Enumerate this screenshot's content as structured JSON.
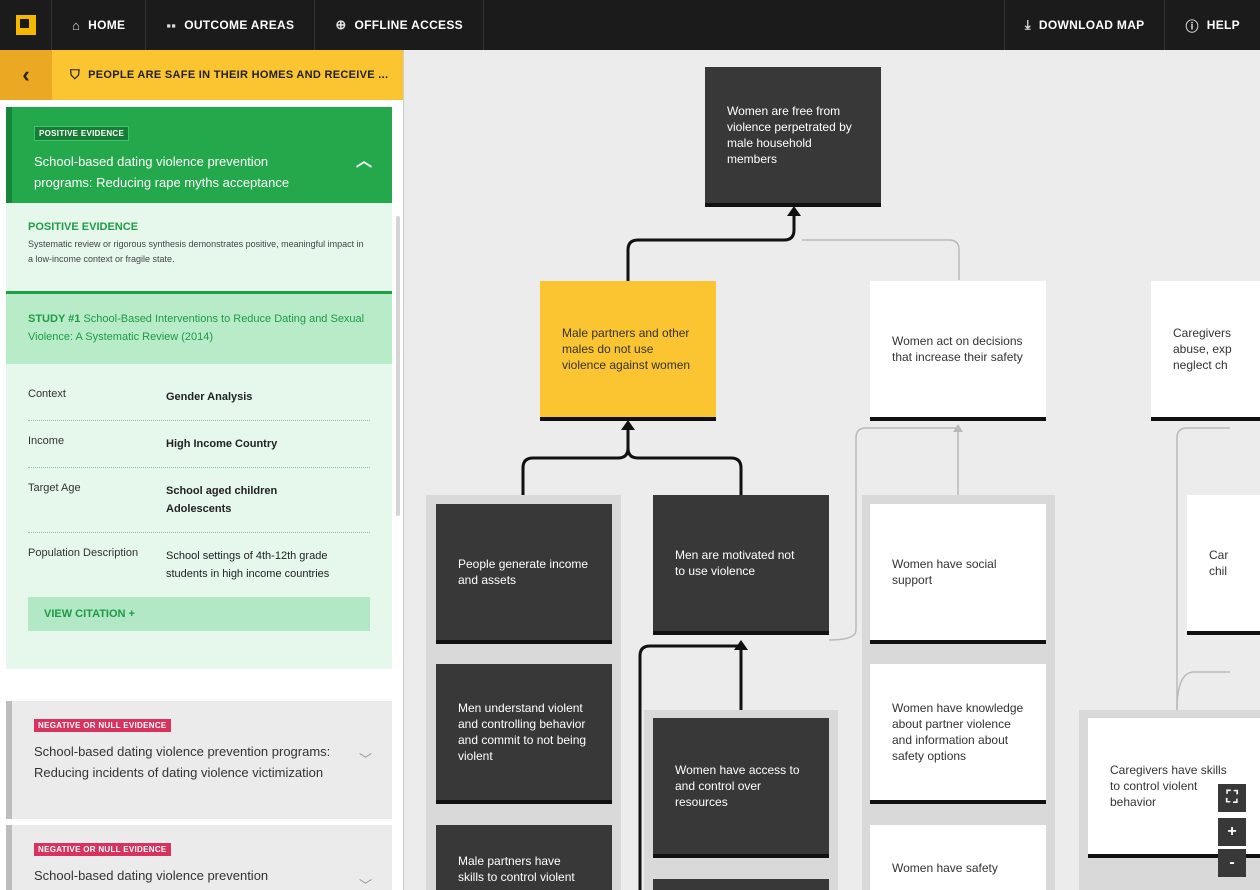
{
  "nav": {
    "home": "HOME",
    "outcome_areas": "OUTCOME AREAS",
    "offline_access": "OFFLINE ACCESS",
    "download_map": "DOWNLOAD MAP",
    "help": "HELP"
  },
  "panel": {
    "title": "PEOPLE ARE SAFE IN THEIR HOMES AND RECEIVE ...",
    "open_card": {
      "badge": "POSITIVE EVIDENCE",
      "title": "School-based dating violence prevention programs: Reducing rape myths acceptance",
      "evidence_title": "POSITIVE EVIDENCE",
      "evidence_desc": "Systematic review or rigorous synthesis demonstrates positive, meaningful impact in a low-income context or fragile state.",
      "study_label": "STUDY #1",
      "study_title": "School-Based Interventions to Reduce Dating and Sexual Violence: A Systematic Review (2014)",
      "details": [
        {
          "label": "Context",
          "value": "Gender Analysis"
        },
        {
          "label": "Income",
          "value": "High Income Country"
        },
        {
          "label": "Target Age",
          "value": "School aged children",
          "value2": "Adolescents"
        },
        {
          "label": "Population Description",
          "value": "School settings of 4th-12th grade students in high income countries"
        }
      ],
      "citation_label": "VIEW CITATION +"
    },
    "closed_cards": [
      {
        "badge": "NEGATIVE OR NULL EVIDENCE",
        "title": "School-based dating violence prevention programs: Reducing incidents of dating violence victimization"
      },
      {
        "badge": "NEGATIVE OR NULL EVIDENCE",
        "title": "School-based dating violence prevention"
      }
    ]
  },
  "map": {
    "nodes": {
      "top": "Women are free from violence perpetrated by male household members",
      "male_partners": "Male partners and other males do not use violence against women",
      "women_act": "Women act on decisions that increase their safety",
      "caregivers_partial": "Caregivers abuse, exp neglect ch",
      "people_generate": "People generate income and assets",
      "men_motivated": "Men are motivated not to use violence",
      "women_social": "Women have social support",
      "car_partial": "Car chil",
      "men_understand": "Men understand violent and controlling behavior and commit to not being violent",
      "women_access": "Women have access to and control over resources",
      "women_knowledge": "Women have knowledge about partner violence and information about safety options",
      "caregivers_skills": "Caregivers have skills to control violent behavior",
      "male_skills": "Male partners have skills to control violent",
      "women_safety": "Women have safety"
    }
  },
  "zoom": {
    "expand": "⛶",
    "plus": "+",
    "minus": "-"
  },
  "colors": {
    "nav_bg": "#1b1b1b",
    "accent_yellow": "#fbc431",
    "positive_green": "#24a84c",
    "negative_pink": "#d8325f",
    "dark_node": "#383838"
  }
}
